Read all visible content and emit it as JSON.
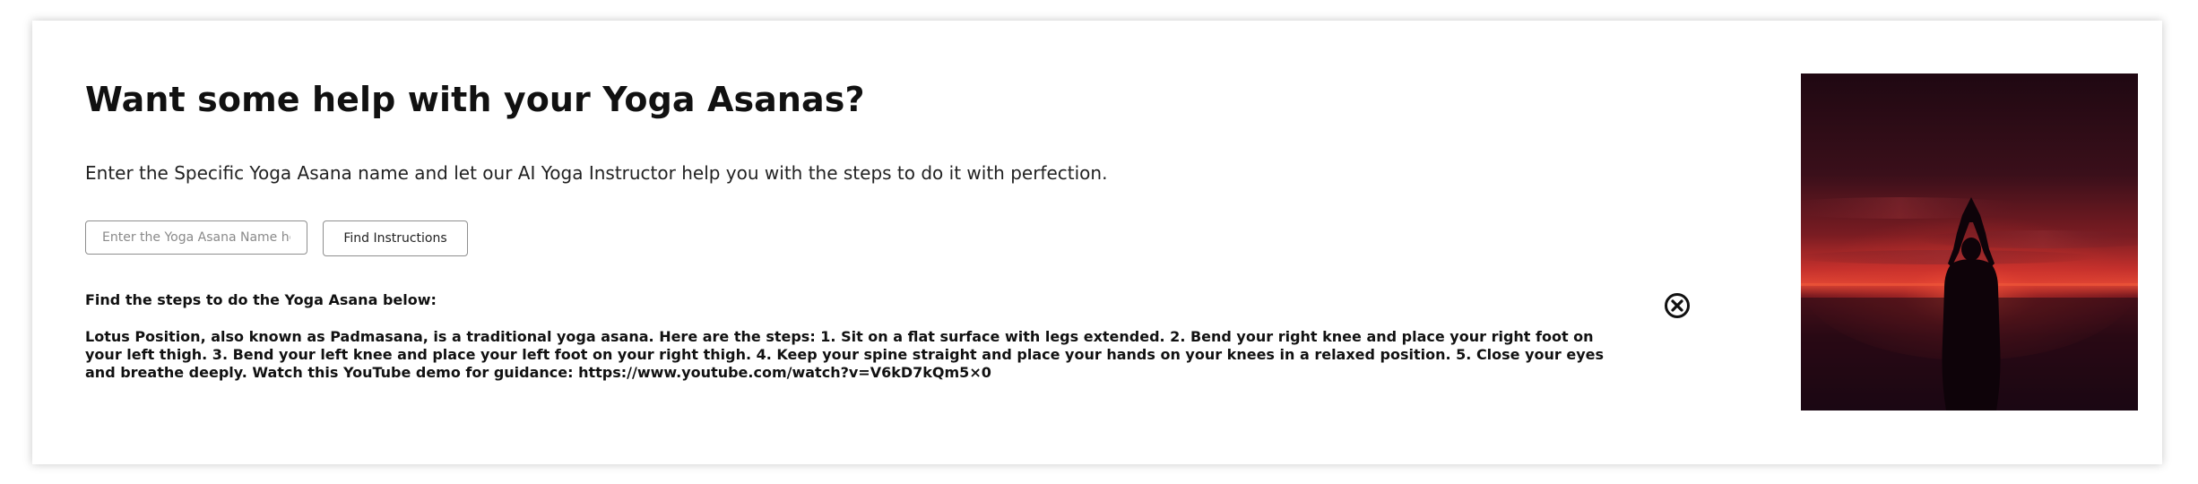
{
  "header": {
    "title": "Want some help with your Yoga Asanas?",
    "subtitle": "Enter the Specific Yoga Asana name and let our AI Yoga Instructor help you with the steps to do it with perfection."
  },
  "search": {
    "placeholder": "Enter the Yoga Asana Name here",
    "value": "",
    "button_label": "Find Instructions"
  },
  "result": {
    "heading": "Find the steps to do the Yoga Asana below:",
    "text": "Lotus Position, also known as Padmasana, is a traditional yoga asana. Here are the steps: 1. Sit on a flat surface with legs extended. 2. Bend your right knee and place your right foot on your left thigh. 3. Bend your left knee and place your left foot on your right thigh. 4. Keep your spine straight and place your hands on your knees in a relaxed position. 5. Close your eyes and breathe deeply. Watch this YouTube demo for guidance: https://www.youtube.com/watch?v=V6kD7kQm5×0",
    "close_icon": "close-circle-icon"
  },
  "image": {
    "subject": "yoga-silhouette-sunset",
    "colors": {
      "sky_top": "#1f0812",
      "sky_glow": "#c4302c",
      "horizon": "#e04634",
      "ground": "#1a0714",
      "silhouette": "#0e0309"
    }
  }
}
